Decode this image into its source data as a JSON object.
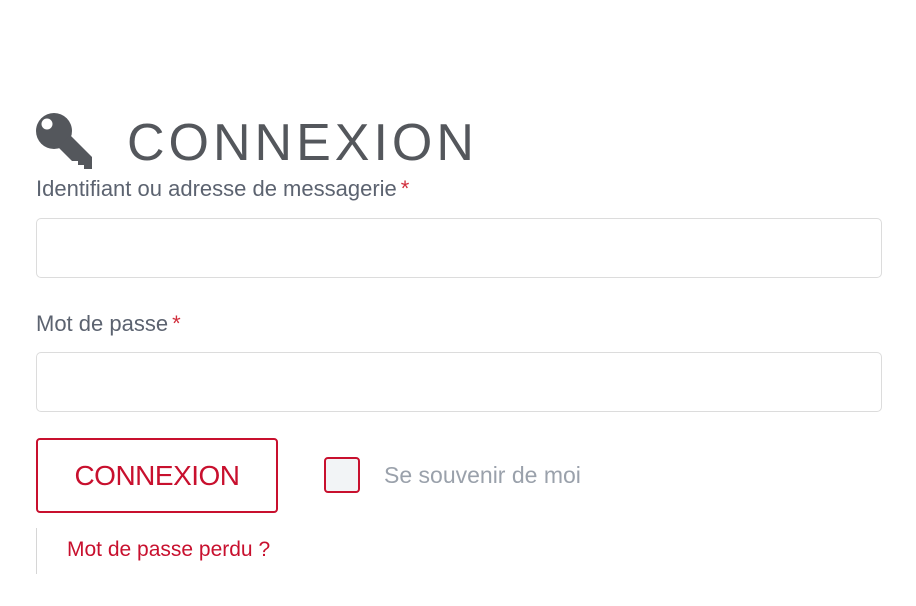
{
  "header": {
    "title": "CONNEXION",
    "icon": "key-icon",
    "icon_color": "#54575c"
  },
  "form": {
    "username": {
      "label": "Identifiant ou adresse de messagerie",
      "required_mark": "*",
      "value": "",
      "placeholder": ""
    },
    "password": {
      "label": "Mot de passe",
      "required_mark": "*",
      "value": "",
      "placeholder": ""
    },
    "submit_label": "CONNEXION",
    "remember_me": {
      "label": "Se souvenir de moi",
      "checked": false
    },
    "lost_password_link": "Mot de passe perdu ?"
  },
  "colors": {
    "accent": "#c8102e",
    "required": "#d12e3c",
    "label_text": "#5c6370",
    "muted_text": "#9aa1ab",
    "input_border": "#dcdcdc"
  }
}
